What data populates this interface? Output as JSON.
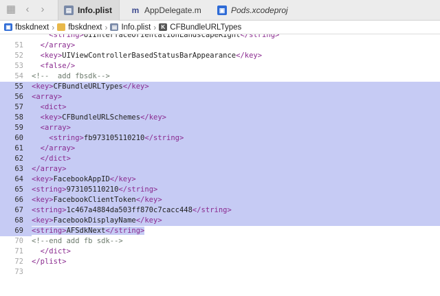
{
  "tabs": [
    {
      "label": "Info.plist",
      "icon": "plist-file-icon",
      "active": true
    },
    {
      "label": "AppDelegate.m",
      "icon": "objc-source-icon",
      "active": false
    },
    {
      "label": "Pods.xcodeproj",
      "icon": "xcodeproj-icon",
      "active": false
    }
  ],
  "breadcrumb": [
    {
      "label": "fbskdnext",
      "icon": "xcodeproj-icon"
    },
    {
      "label": "fbskdnext",
      "icon": "folder-icon"
    },
    {
      "label": "Info.plist",
      "icon": "plist-file-icon"
    },
    {
      "label": "CFBundleURLTypes",
      "icon": "key-icon"
    }
  ],
  "colors": {
    "selection": "#c6cbf4",
    "tag": "#8a2a8f",
    "comment": "#6c7a6c"
  },
  "lines": [
    {
      "n": "",
      "indent": "    ",
      "parts": [
        [
          "tag",
          "<string>"
        ],
        [
          "txt",
          "UIInterfaceOrientationLandscapeRight"
        ],
        [
          "tag",
          "</string>"
        ]
      ],
      "sel": false
    },
    {
      "n": "51",
      "indent": "  ",
      "parts": [
        [
          "tag",
          "</array>"
        ]
      ],
      "sel": false
    },
    {
      "n": "52",
      "indent": "  ",
      "parts": [
        [
          "tag",
          "<key>"
        ],
        [
          "txt",
          "UIViewControllerBasedStatusBarAppearance"
        ],
        [
          "tag",
          "</key>"
        ]
      ],
      "sel": false
    },
    {
      "n": "53",
      "indent": "  ",
      "parts": [
        [
          "tag",
          "<false/>"
        ]
      ],
      "sel": false
    },
    {
      "n": "54",
      "indent": "",
      "parts": [
        [
          "cmt",
          "<!--  add fbsdk-->"
        ]
      ],
      "sel": false
    },
    {
      "n": "55",
      "indent": "",
      "parts": [
        [
          "tag",
          "<key>"
        ],
        [
          "txt",
          "CFBundleURLTypes"
        ],
        [
          "tag",
          "</key>"
        ]
      ],
      "sel": true
    },
    {
      "n": "56",
      "indent": "",
      "parts": [
        [
          "tag",
          "<array>"
        ]
      ],
      "sel": true
    },
    {
      "n": "57",
      "indent": "  ",
      "parts": [
        [
          "tag",
          "<dict>"
        ]
      ],
      "sel": true
    },
    {
      "n": "58",
      "indent": "  ",
      "parts": [
        [
          "tag",
          "<key>"
        ],
        [
          "txt",
          "CFBundleURLSchemes"
        ],
        [
          "tag",
          "</key>"
        ]
      ],
      "sel": true
    },
    {
      "n": "59",
      "indent": "  ",
      "parts": [
        [
          "tag",
          "<array>"
        ]
      ],
      "sel": true
    },
    {
      "n": "60",
      "indent": "    ",
      "parts": [
        [
          "tag",
          "<string>"
        ],
        [
          "txt",
          "fb973105110210"
        ],
        [
          "tag",
          "</string>"
        ]
      ],
      "sel": true
    },
    {
      "n": "61",
      "indent": "  ",
      "parts": [
        [
          "tag",
          "</array>"
        ]
      ],
      "sel": true
    },
    {
      "n": "62",
      "indent": "  ",
      "parts": [
        [
          "tag",
          "</dict>"
        ]
      ],
      "sel": true
    },
    {
      "n": "63",
      "indent": "",
      "parts": [
        [
          "tag",
          "</array>"
        ]
      ],
      "sel": true
    },
    {
      "n": "64",
      "indent": "",
      "parts": [
        [
          "tag",
          "<key>"
        ],
        [
          "txt",
          "FacebookAppID"
        ],
        [
          "tag",
          "</key>"
        ]
      ],
      "sel": true
    },
    {
      "n": "65",
      "indent": "",
      "parts": [
        [
          "tag",
          "<string>"
        ],
        [
          "txt",
          "973105110210"
        ],
        [
          "tag",
          "</string>"
        ]
      ],
      "sel": true
    },
    {
      "n": "66",
      "indent": "",
      "parts": [
        [
          "tag",
          "<key>"
        ],
        [
          "txt",
          "FacebookClientToken"
        ],
        [
          "tag",
          "</key>"
        ]
      ],
      "sel": true
    },
    {
      "n": "67",
      "indent": "",
      "parts": [
        [
          "tag",
          "<string>"
        ],
        [
          "txt",
          "1c467a4884da503ff870c7cacc448"
        ],
        [
          "tag",
          "</string>"
        ]
      ],
      "sel": true
    },
    {
      "n": "68",
      "indent": "",
      "parts": [
        [
          "tag",
          "<key>"
        ],
        [
          "txt",
          "FacebookDisplayName"
        ],
        [
          "tag",
          "</key>"
        ]
      ],
      "sel": true
    },
    {
      "n": "69",
      "indent": "",
      "parts": [
        [
          "tag",
          "<string>"
        ],
        [
          "txt",
          "AFSdkNext"
        ],
        [
          "tag",
          "</string>"
        ]
      ],
      "sel": "partial"
    },
    {
      "n": "70",
      "indent": "",
      "parts": [
        [
          "cmt",
          "<!--end add fb sdk-->"
        ]
      ],
      "sel": false
    },
    {
      "n": "71",
      "indent": "  ",
      "parts": [
        [
          "tag",
          "</dict>"
        ]
      ],
      "sel": false
    },
    {
      "n": "72",
      "indent": "",
      "parts": [
        [
          "tag",
          "</plist>"
        ]
      ],
      "sel": false
    },
    {
      "n": "73",
      "indent": "",
      "parts": [],
      "sel": false
    }
  ]
}
